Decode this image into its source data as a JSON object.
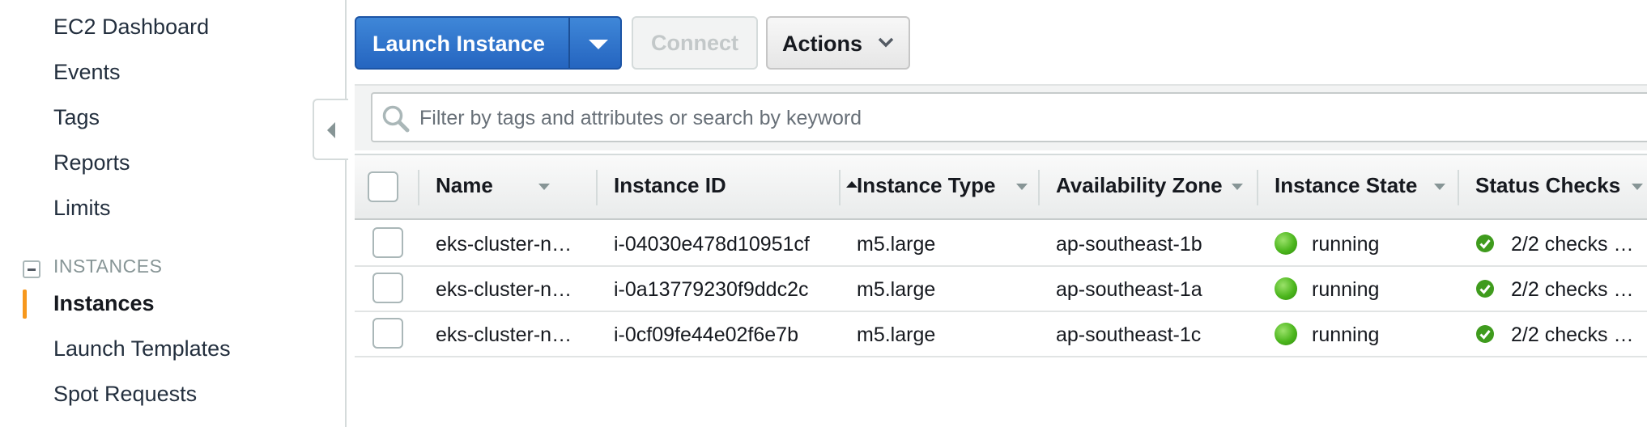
{
  "sidebar": {
    "items_top": [
      "EC2 Dashboard",
      "Events",
      "Tags",
      "Reports",
      "Limits"
    ],
    "section_heading": "INSTANCES",
    "items_instances": [
      "Instances",
      "Launch Templates",
      "Spot Requests"
    ],
    "active_item": "Instances"
  },
  "toolbar": {
    "launch_label": "Launch Instance",
    "connect_label": "Connect",
    "actions_label": "Actions"
  },
  "search": {
    "placeholder": "Filter by tags and attributes or search by keyword"
  },
  "table": {
    "columns": [
      "Name",
      "Instance ID",
      "Instance Type",
      "Availability Zone",
      "Instance State",
      "Status Checks"
    ],
    "sorted_column": "Instance ID",
    "rows": [
      {
        "name": "eks-cluster-n…",
        "instance_id": "i-04030e478d10951cf",
        "instance_type": "m5.large",
        "availability_zone": "ap-southeast-1b",
        "instance_state": "running",
        "status_checks": "2/2 checks …"
      },
      {
        "name": "eks-cluster-n…",
        "instance_id": "i-0a13779230f9ddc2c",
        "instance_type": "m5.large",
        "availability_zone": "ap-southeast-1a",
        "instance_state": "running",
        "status_checks": "2/2 checks …"
      },
      {
        "name": "eks-cluster-n…",
        "instance_id": "i-0cf09fe44e02f6e7b",
        "instance_type": "m5.large",
        "availability_zone": "ap-southeast-1c",
        "instance_state": "running",
        "status_checks": "2/2 checks …"
      }
    ]
  },
  "colors": {
    "primary_button": "#2565c0",
    "active_indicator": "#f7981d",
    "running_green": "#4cb61d"
  },
  "icons": {
    "collapse": "caret-left-icon",
    "launch_dropdown": "caret-down-icon",
    "actions_dropdown": "chevron-down-icon",
    "search": "search-icon",
    "state": "status-dot-icon",
    "checks": "check-circle-icon"
  }
}
